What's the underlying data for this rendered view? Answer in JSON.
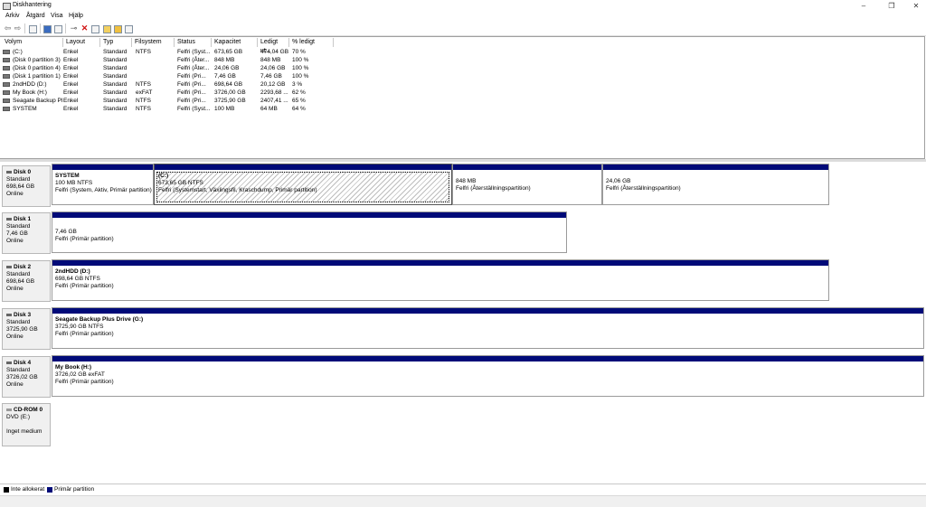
{
  "window": {
    "title": "Diskhantering",
    "minimize": "–",
    "maximize": "❐",
    "close": "✕"
  },
  "menu": [
    "Arkiv",
    "Åtgärd",
    "Visa",
    "Hjälp"
  ],
  "toolbar_icons": [
    "back-arrow-icon",
    "forward-arrow-icon",
    "list-view-icon",
    "help-icon",
    "properties-icon",
    "connect-icon",
    "delete-icon",
    "check-icon",
    "new-icon",
    "folder-icon",
    "details-icon"
  ],
  "table": {
    "headers": [
      "Volym",
      "Layout",
      "Typ",
      "Filsystem",
      "Status",
      "Kapacitet",
      "Ledigt ut...",
      "% ledigt"
    ],
    "rows": [
      [
        "(C:)",
        "Enkel",
        "Standard",
        "NTFS",
        "Felfri (Syst...",
        "673,65 GB",
        "474,04 GB",
        "70 %"
      ],
      [
        "(Disk 0 partition 3)",
        "Enkel",
        "Standard",
        "",
        "Felfri (Åter...",
        "848 MB",
        "848 MB",
        "100 %"
      ],
      [
        "(Disk 0 partition 4)",
        "Enkel",
        "Standard",
        "",
        "Felfri (Åter...",
        "24,06 GB",
        "24,06 GB",
        "100 %"
      ],
      [
        "(Disk 1 partition 1)",
        "Enkel",
        "Standard",
        "",
        "Felfri (Pri...",
        "7,46 GB",
        "7,46 GB",
        "100 %"
      ],
      [
        "2ndHDD (D:)",
        "Enkel",
        "Standard",
        "NTFS",
        "Felfri (Pri...",
        "698,64 GB",
        "20,12 GB",
        "3 %"
      ],
      [
        "My Book (H:)",
        "Enkel",
        "Standard",
        "exFAT",
        "Felfri (Pri...",
        "3726,00 GB",
        "2293,68 ...",
        "62 %"
      ],
      [
        "Seagate Backup Pl...",
        "Enkel",
        "Standard",
        "NTFS",
        "Felfri (Pri...",
        "3725,90 GB",
        "2407,41 ...",
        "65 %"
      ],
      [
        "SYSTEM",
        "Enkel",
        "Standard",
        "NTFS",
        "Felfri (Syst...",
        "100 MB",
        "64 MB",
        "64 %"
      ]
    ]
  },
  "disks": [
    {
      "name": "Disk 0",
      "type": "Standard",
      "size": "698,64 GB",
      "status": "Online",
      "partitions": [
        {
          "name": "SYSTEM",
          "size": "100 MB NTFS",
          "status": "Felfri (System, Aktiv, Primär partition)"
        },
        {
          "name": "(C:)",
          "size": "673,65 GB NTFS",
          "status": "Felfri (Systemstart, Växlingsfil, Kraschdump, Primär partition)"
        },
        {
          "name": "",
          "size": "848 MB",
          "status": "Felfri (Återställningspartition)"
        },
        {
          "name": "",
          "size": "24,06 GB",
          "status": "Felfri (Återställningspartition)"
        }
      ]
    },
    {
      "name": "Disk 1",
      "type": "Standard",
      "size": "7,46 GB",
      "status": "Online",
      "partitions": [
        {
          "name": "",
          "size": "7,46 GB",
          "status": "Felfri (Primär partition)"
        }
      ]
    },
    {
      "name": "Disk 2",
      "type": "Standard",
      "size": "698,64 GB",
      "status": "Online",
      "partitions": [
        {
          "name": "2ndHDD (D:)",
          "size": "698,64 GB NTFS",
          "status": "Felfri (Primär partition)"
        }
      ]
    },
    {
      "name": "Disk 3",
      "type": "Standard",
      "size": "3725,90 GB",
      "status": "Online",
      "partitions": [
        {
          "name": "Seagate Backup Plus Drive (G:)",
          "size": "3725,90 GB NTFS",
          "status": "Felfri (Primär partition)"
        }
      ]
    },
    {
      "name": "Disk 4",
      "type": "Standard",
      "size": "3726,02 GB",
      "status": "Online",
      "partitions": [
        {
          "name": "My Book (H:)",
          "size": "3726,02 GB exFAT",
          "status": "Felfri (Primär partition)"
        }
      ]
    }
  ],
  "cdrom": {
    "name": "CD-ROM 0",
    "drive": "DVD (E:)",
    "media": "Inget medium"
  },
  "legend": [
    {
      "label": "Inte allokerat",
      "color": "#000000"
    },
    {
      "label": "Primär partition",
      "color": "#000a78"
    }
  ]
}
